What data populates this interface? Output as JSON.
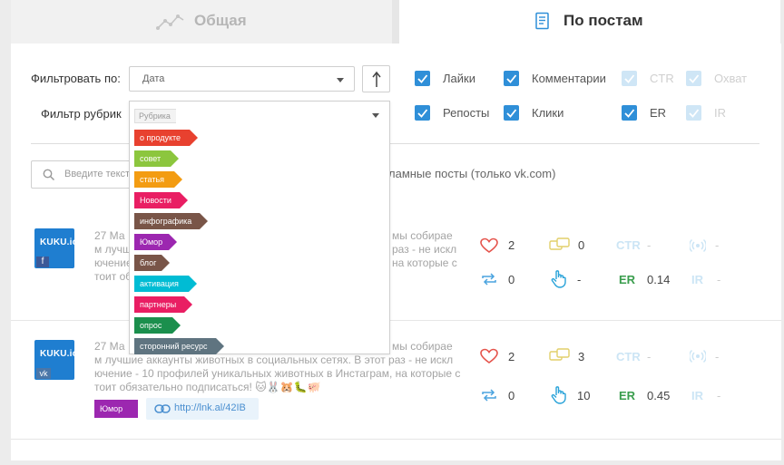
{
  "tabs": {
    "general": "Общая",
    "by_posts": "По постам"
  },
  "filter": {
    "label": "Фильтровать по:",
    "value": "Дата",
    "rubric_label": "Фильтр рубрик",
    "rubric_placeholder": "Рубрика"
  },
  "checkboxes": {
    "likes": "Лайки",
    "comments": "Комментарии",
    "ctr": "CTR",
    "reach": "Охват",
    "reposts": "Репосты",
    "clicks": "Клики",
    "er": "ER",
    "ir": "IR"
  },
  "search": {
    "placeholder": "Введите текст"
  },
  "promo_label": "ламные посты (только vk.com)",
  "rubrics": [
    {
      "label": "о продукте",
      "color": "#e8412f"
    },
    {
      "label": "совет",
      "color": "#8cc63e"
    },
    {
      "label": "статья",
      "color": "#f39c12"
    },
    {
      "label": "Новости",
      "color": "#e91e63"
    },
    {
      "label": "инфографика",
      "color": "#795548"
    },
    {
      "label": "Юмор",
      "color": "#9c27b0"
    },
    {
      "label": "блог",
      "color": "#795548"
    },
    {
      "label": "активация",
      "color": "#00bcd4"
    },
    {
      "label": "партнеры",
      "color": "#e91e63"
    },
    {
      "label": "опрос",
      "color": "#1b8f4d"
    },
    {
      "label": "сторонний ресурс",
      "color": "#5f7480"
    }
  ],
  "posts": [
    {
      "avatar": "KUKU.io",
      "network": "f",
      "date": "27 Ма",
      "text_lines": [
        "мы собирае",
        "раз - не искл",
        "на которые с"
      ],
      "left_lines": [
        "м лучше",
        "ючение",
        "тоит об"
      ],
      "likes": "2",
      "comments": "0",
      "ctr": "CTR",
      "ctr_val": "-",
      "reach_val": "-",
      "reposts": "0",
      "clicks": "-",
      "er": "ER",
      "er_val": "0.14",
      "ir": "IR",
      "ir_val": "-"
    },
    {
      "avatar": "KUKU.io",
      "network": "vk",
      "date": "27 Ма",
      "text_lines": [
        "мы собирае",
        "м лучшие аккаунты животных в социальных сетях. В этот раз - не искл",
        "ючение - 10 профилей уникальных животных в Инстаграм, на которые с",
        "тоит обязательно подписаться! 🐱🐰🐹🐛🐖"
      ],
      "tag": "Юмор",
      "link": "http://lnk.al/42IB",
      "likes": "2",
      "comments": "3",
      "ctr": "CTR",
      "ctr_val": "-",
      "reach_val": "-",
      "reposts": "0",
      "clicks": "10",
      "er": "ER",
      "er_val": "0.45",
      "ir": "IR",
      "ir_val": "-"
    }
  ],
  "colors": {
    "accent": "#2f8fd8",
    "er": "#3a9d4d",
    "tag_humor": "#9c27b0"
  }
}
